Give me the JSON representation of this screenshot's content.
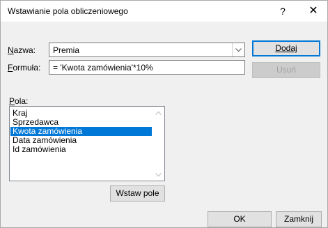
{
  "window": {
    "title": "Wstawianie pola obliczeniowego",
    "help_glyph": "?",
    "close_glyph": "✕"
  },
  "form": {
    "name_label_hot": "N",
    "name_label_rest": "azwa:",
    "name_value": "Premia",
    "formula_label_hot": "F",
    "formula_label_rest": "ormuła:",
    "formula_value": "= 'Kwota zamówienia'*10%"
  },
  "buttons": {
    "add_label": "Dodaj",
    "delete_label": "Usuń",
    "insert_field_label": "Wstaw pole",
    "ok_label": "OK",
    "close_label": "Zamknij"
  },
  "fields": {
    "label_hot": "P",
    "label_rest": "ola:",
    "items": [
      "Kraj",
      "Sprzedawca",
      "Kwota zamówienia",
      "Data zamówienia",
      "Id zamówienia"
    ],
    "selected_index": 2
  },
  "icons": {
    "dropdown": "chevron-down-icon",
    "scroll_up": "chevron-up-icon",
    "scroll_down": "chevron-down-icon",
    "help": "question-mark-icon",
    "close": "close-icon"
  },
  "colors": {
    "accent": "#0078d7",
    "dialog_bg": "#f0f0f0"
  }
}
